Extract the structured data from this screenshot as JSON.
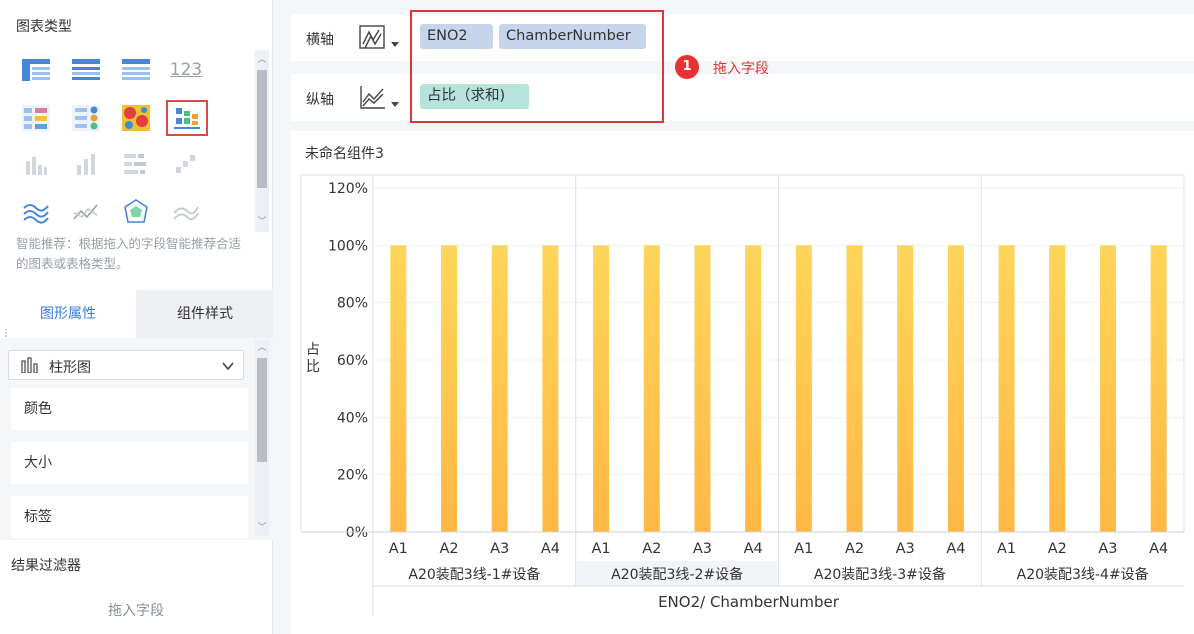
{
  "left_panel": {
    "chart_type_title": "图表类型",
    "chart_types": [
      {
        "icon": "cross-table-icon"
      },
      {
        "icon": "group-table-icon"
      },
      {
        "icon": "detail-table-icon"
      },
      {
        "icon": "kpi-number-icon",
        "text": "123"
      },
      {
        "icon": "multi-value-table-icon"
      },
      {
        "icon": "color-list-icon"
      },
      {
        "icon": "heatmap-icon"
      },
      {
        "icon": "multi-series-bar-icon",
        "selected": true
      },
      {
        "icon": "bar-chart-faded-icon"
      },
      {
        "icon": "column-chart-faded-icon"
      },
      {
        "icon": "stacked-bar-faded-icon"
      },
      {
        "icon": "waterfall-faded-icon"
      },
      {
        "icon": "area-wave-icon"
      },
      {
        "icon": "line-chart-icon"
      },
      {
        "icon": "radar-chart-icon"
      },
      {
        "icon": "multi-line-icon"
      }
    ],
    "hint": "智能推荐：根据拖入的字段智能推荐合适的图表或表格类型。",
    "tabs": [
      {
        "label": "图形属性",
        "active": true
      },
      {
        "label": "组件样式",
        "active": false
      }
    ],
    "chart_select": "柱形图",
    "properties": [
      "颜色",
      "大小",
      "标签"
    ],
    "filter_title": "结果过滤器",
    "filter_drop": "拖入字段"
  },
  "axes": {
    "x": {
      "label": "横轴",
      "fields": [
        "ENO2",
        "ChamberNumber"
      ]
    },
    "y": {
      "label": "纵轴",
      "fields": [
        "占比（求和)"
      ]
    }
  },
  "callout": {
    "number": "1",
    "text": "拖入字段"
  },
  "component_title": "未命名组件3",
  "colors": {
    "bar_top": "#ffd55a",
    "bar_bottom": "#ffb845",
    "dimension_pill": "#c6d4ec",
    "measure_pill": "#b6e3dc",
    "accent_blue": "#3a7be8",
    "annotation_red": "#e83232"
  },
  "chart_data": {
    "type": "bar",
    "ylabel": "占比",
    "xlabel": "ENO2/ ChamberNumber",
    "yticks": [
      "0%",
      "20%",
      "40%",
      "60%",
      "80%",
      "100%",
      "120%"
    ],
    "ylim": [
      0,
      1.2
    ],
    "groups": [
      {
        "name": "A20装配3线-1#设备",
        "categories": [
          "A1",
          "A2",
          "A3",
          "A4"
        ],
        "values": [
          1,
          1,
          1,
          1
        ]
      },
      {
        "name": "A20装配3线-2#设备",
        "categories": [
          "A1",
          "A2",
          "A3",
          "A4"
        ],
        "values": [
          1,
          1,
          1,
          1
        ],
        "highlighted": true
      },
      {
        "name": "A20装配3线-3#设备",
        "categories": [
          "A1",
          "A2",
          "A3",
          "A4"
        ],
        "values": [
          1,
          1,
          1,
          1
        ]
      },
      {
        "name": "A20装配3线-4#设备",
        "categories": [
          "A1",
          "A2",
          "A3",
          "A4"
        ],
        "values": [
          1,
          1,
          1,
          1
        ]
      }
    ],
    "grid": "horizontal"
  }
}
